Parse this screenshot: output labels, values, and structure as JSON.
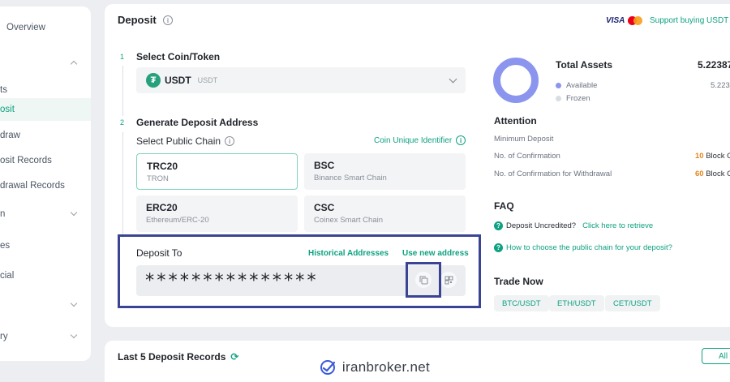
{
  "sidebar": {
    "items": [
      {
        "label": "Overview",
        "active": false,
        "chevron": ""
      },
      {
        "label": "",
        "active": false,
        "chevron": "up"
      },
      {
        "label": "ts",
        "active": false,
        "chevron": ""
      },
      {
        "label": "osit",
        "active": true,
        "chevron": ""
      },
      {
        "label": "draw",
        "active": false,
        "chevron": ""
      },
      {
        "label": "osit Records",
        "active": false,
        "chevron": ""
      },
      {
        "label": "drawal Records",
        "active": false,
        "chevron": ""
      },
      {
        "label": "n",
        "active": false,
        "chevron": "down"
      },
      {
        "label": "es",
        "active": false,
        "chevron": ""
      },
      {
        "label": "cial",
        "active": false,
        "chevron": ""
      },
      {
        "label": "",
        "active": false,
        "chevron": "down"
      },
      {
        "label": "ry",
        "active": false,
        "chevron": "down"
      }
    ]
  },
  "header": {
    "title": "Deposit",
    "visa": "VISA",
    "support_link": "Support buying USDT"
  },
  "step1": {
    "number": "1",
    "label": "Select Coin/Token",
    "coin_symbol": "USDT",
    "coin_sub": "USDT",
    "coin_icon": "₮"
  },
  "step2": {
    "number": "2",
    "label": "Generate Deposit Address",
    "chain_label": "Select Public Chain",
    "coin_id_link": "Coin Unique Identifier",
    "chains": [
      {
        "name": "TRC20",
        "sub": "TRON",
        "selected": true
      },
      {
        "name": "BSC",
        "sub": "Binance Smart Chain",
        "selected": false
      },
      {
        "name": "ERC20",
        "sub": "Ethereum/ERC-20",
        "selected": false
      },
      {
        "name": "CSC",
        "sub": "Coinex Smart Chain",
        "selected": false
      }
    ]
  },
  "deposit_to": {
    "label": "Deposit To",
    "historical_link": "Historical Addresses",
    "new_address_link": "Use new address",
    "address": "***************"
  },
  "assets": {
    "total_label": "Total Assets",
    "total_value": "5.22387",
    "available_label": "Available",
    "available_value": "5.223",
    "frozen_label": "Frozen",
    "available_color": "#8c95ee",
    "frozen_color": "#d9dde2"
  },
  "attention": {
    "title": "Attention",
    "min_deposit_label": "Minimum Deposit",
    "confirm_label": "No. of Confirmation",
    "confirm_value": "10",
    "confirm_unit": "Block C",
    "withdraw_confirm_label": "No. of Confirmation for Withdrawal",
    "withdraw_confirm_value": "60",
    "withdraw_confirm_unit": "Block C"
  },
  "faq": {
    "title": "FAQ",
    "q1_text": "Deposit Uncredited?",
    "q1_link": "Click here to retrieve",
    "q2_link": "How to choose the public chain for your deposit?"
  },
  "trade": {
    "title": "Trade Now",
    "pairs": [
      "BTC/USDT",
      "ETH/USDT",
      "CET/USDT"
    ]
  },
  "records": {
    "title": "Last 5 Deposit Records",
    "all_button": "All"
  },
  "watermark": {
    "text": "iranbroker.net"
  },
  "colors": {
    "accent": "#0fa181",
    "highlight_border": "#3b4494",
    "warning": "#e2871e"
  }
}
